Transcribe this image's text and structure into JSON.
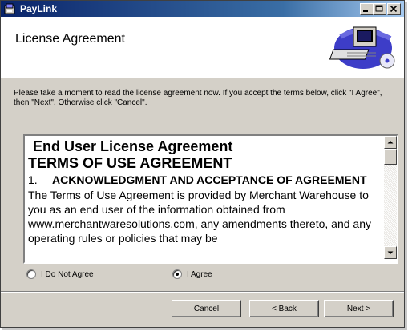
{
  "window": {
    "title": "PayLink"
  },
  "titlebar": {
    "minimize": "minimize",
    "maximize": "maximize",
    "close": "close"
  },
  "header": {
    "title": "License Agreement",
    "art_icon": "computer-cd-icon"
  },
  "instructions": "Please take a moment to read the license agreement now. If you accept the terms below, click \"I Agree\", then \"Next\". Otherwise click \"Cancel\".",
  "license": {
    "heading": "End User License Agreement",
    "subheading": "TERMS OF USE AGREEMENT",
    "section_number": "1.",
    "section_title": "ACKNOWLEDGMENT AND ACCEPTANCE OF AGREEMENT",
    "body": "The Terms of Use Agreement is provided by Merchant Warehouse to you as an end user of the information obtained from www.merchantwaresolutions.com, any amendments thereto, and any operating rules or policies that may be"
  },
  "options": {
    "disagree_label": "I Do Not Agree",
    "agree_label": "I Agree",
    "selected": "agree"
  },
  "buttons": {
    "cancel": "Cancel",
    "back": "< Back",
    "next": "Next >"
  }
}
